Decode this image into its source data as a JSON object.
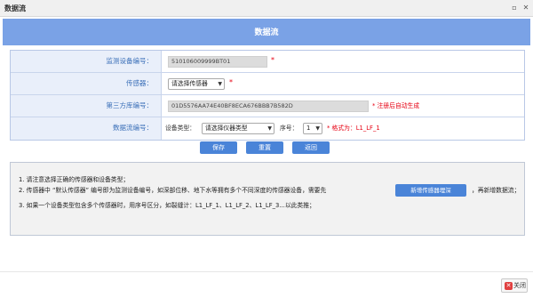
{
  "window": {
    "title": "数据流",
    "restore_glyph": "▫",
    "close_glyph": "✕"
  },
  "header": {
    "title": "数据流"
  },
  "form": {
    "device_code": {
      "label": "监测设备编号：",
      "value": "510106009999BT01",
      "required_mark": "*"
    },
    "sensor": {
      "label": "传感器：",
      "selected": "请选择传感器",
      "required_mark": "*"
    },
    "third_party_code": {
      "label": "第三方库编号：",
      "value": "01D5576AA74E40BF8ECA676BBB7B582D",
      "note": "* 注册后自动生成"
    },
    "stream_code": {
      "label": "数据流编号：",
      "device_type_label": "设备类型：",
      "device_type_selected": "请选择仪器类型",
      "seq_label": "序号：",
      "seq_selected": "1",
      "format_note": "* 格式为：L1_LF_1"
    }
  },
  "buttons": {
    "save": "保存",
    "reset": "重置",
    "back": "返回"
  },
  "notes": {
    "line1": "1. 请注意选择正确的传感器和设备类型；",
    "line2_before": "2. 传感器中 “默认传感器” 编号即为监测设备编号，如深部位移、地下水等拥有多个不同深度的传感器设备，需要先",
    "add_sensor_button": "新增传感器埋深",
    "line2_after": "，再新增数据流；",
    "line3": "3. 如果一个设备类型包含多个传感器时，用序号区分，如裂缝计：L1_LF_1、L1_LF_2、L1_LF_3...以此类推；"
  },
  "footer": {
    "close_label": "关闭"
  },
  "colors": {
    "header": "#7aa2e6",
    "button": "#4a84d8",
    "label": "#3a6fb8",
    "required": "#e60012"
  }
}
